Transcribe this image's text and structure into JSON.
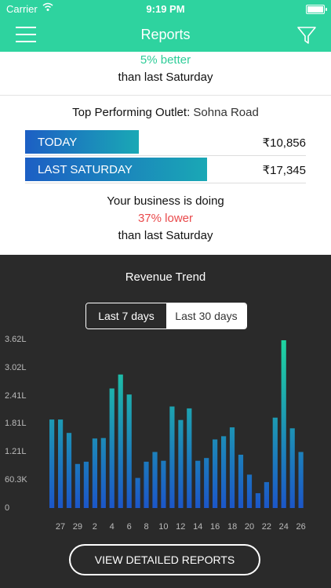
{
  "status_bar": {
    "carrier": "Carrier",
    "time": "9:19 PM"
  },
  "nav": {
    "title": "Reports",
    "menu_icon": "hamburger-icon",
    "filter_icon": "filter-icon"
  },
  "summary_top": {
    "percent": "5% better",
    "comparison": "than last Saturday"
  },
  "outlet": {
    "prefix": "Top Performing Outlet:",
    "name": "Sohna Road",
    "bars": [
      {
        "label": "TODAY",
        "amount": "₹10,856",
        "fraction": 0.626
      },
      {
        "label": "LAST SATURDAY",
        "amount": "₹17,345",
        "fraction": 1.0
      }
    ]
  },
  "business": {
    "line1": "Your business is doing",
    "percent": "37% lower",
    "line3": "than last Saturday"
  },
  "revenue_trend": {
    "title": "Revenue Trend",
    "tabs": [
      {
        "label": "Last 7 days",
        "active": true
      },
      {
        "label": "Last 30 days",
        "active": false
      }
    ],
    "button": "VIEW DETAILED REPORTS"
  },
  "chart_data": {
    "type": "bar",
    "title": "Revenue Trend",
    "y_tick_labels": [
      "3.62L",
      "3.02L",
      "2.41L",
      "1.81L",
      "1.21L",
      "60.3K",
      "0"
    ],
    "x_tick_labels": [
      "27",
      "29",
      "2",
      "4",
      "6",
      "8",
      "10",
      "12",
      "14",
      "16",
      "18",
      "20",
      "22",
      "24",
      "26"
    ],
    "ylim": [
      0,
      362000
    ],
    "values": [
      191000,
      191000,
      162000,
      95000,
      100000,
      150000,
      151000,
      258000,
      288000,
      245000,
      65000,
      100000,
      121000,
      102000,
      219000,
      190000,
      215000,
      102000,
      108000,
      148000,
      155000,
      174000,
      115000,
      72000,
      32000,
      56000,
      195000,
      362000,
      172000,
      121000
    ],
    "colors": {
      "top": "#1ed6a0",
      "bottom": "#1c56c8"
    },
    "grid": false
  }
}
